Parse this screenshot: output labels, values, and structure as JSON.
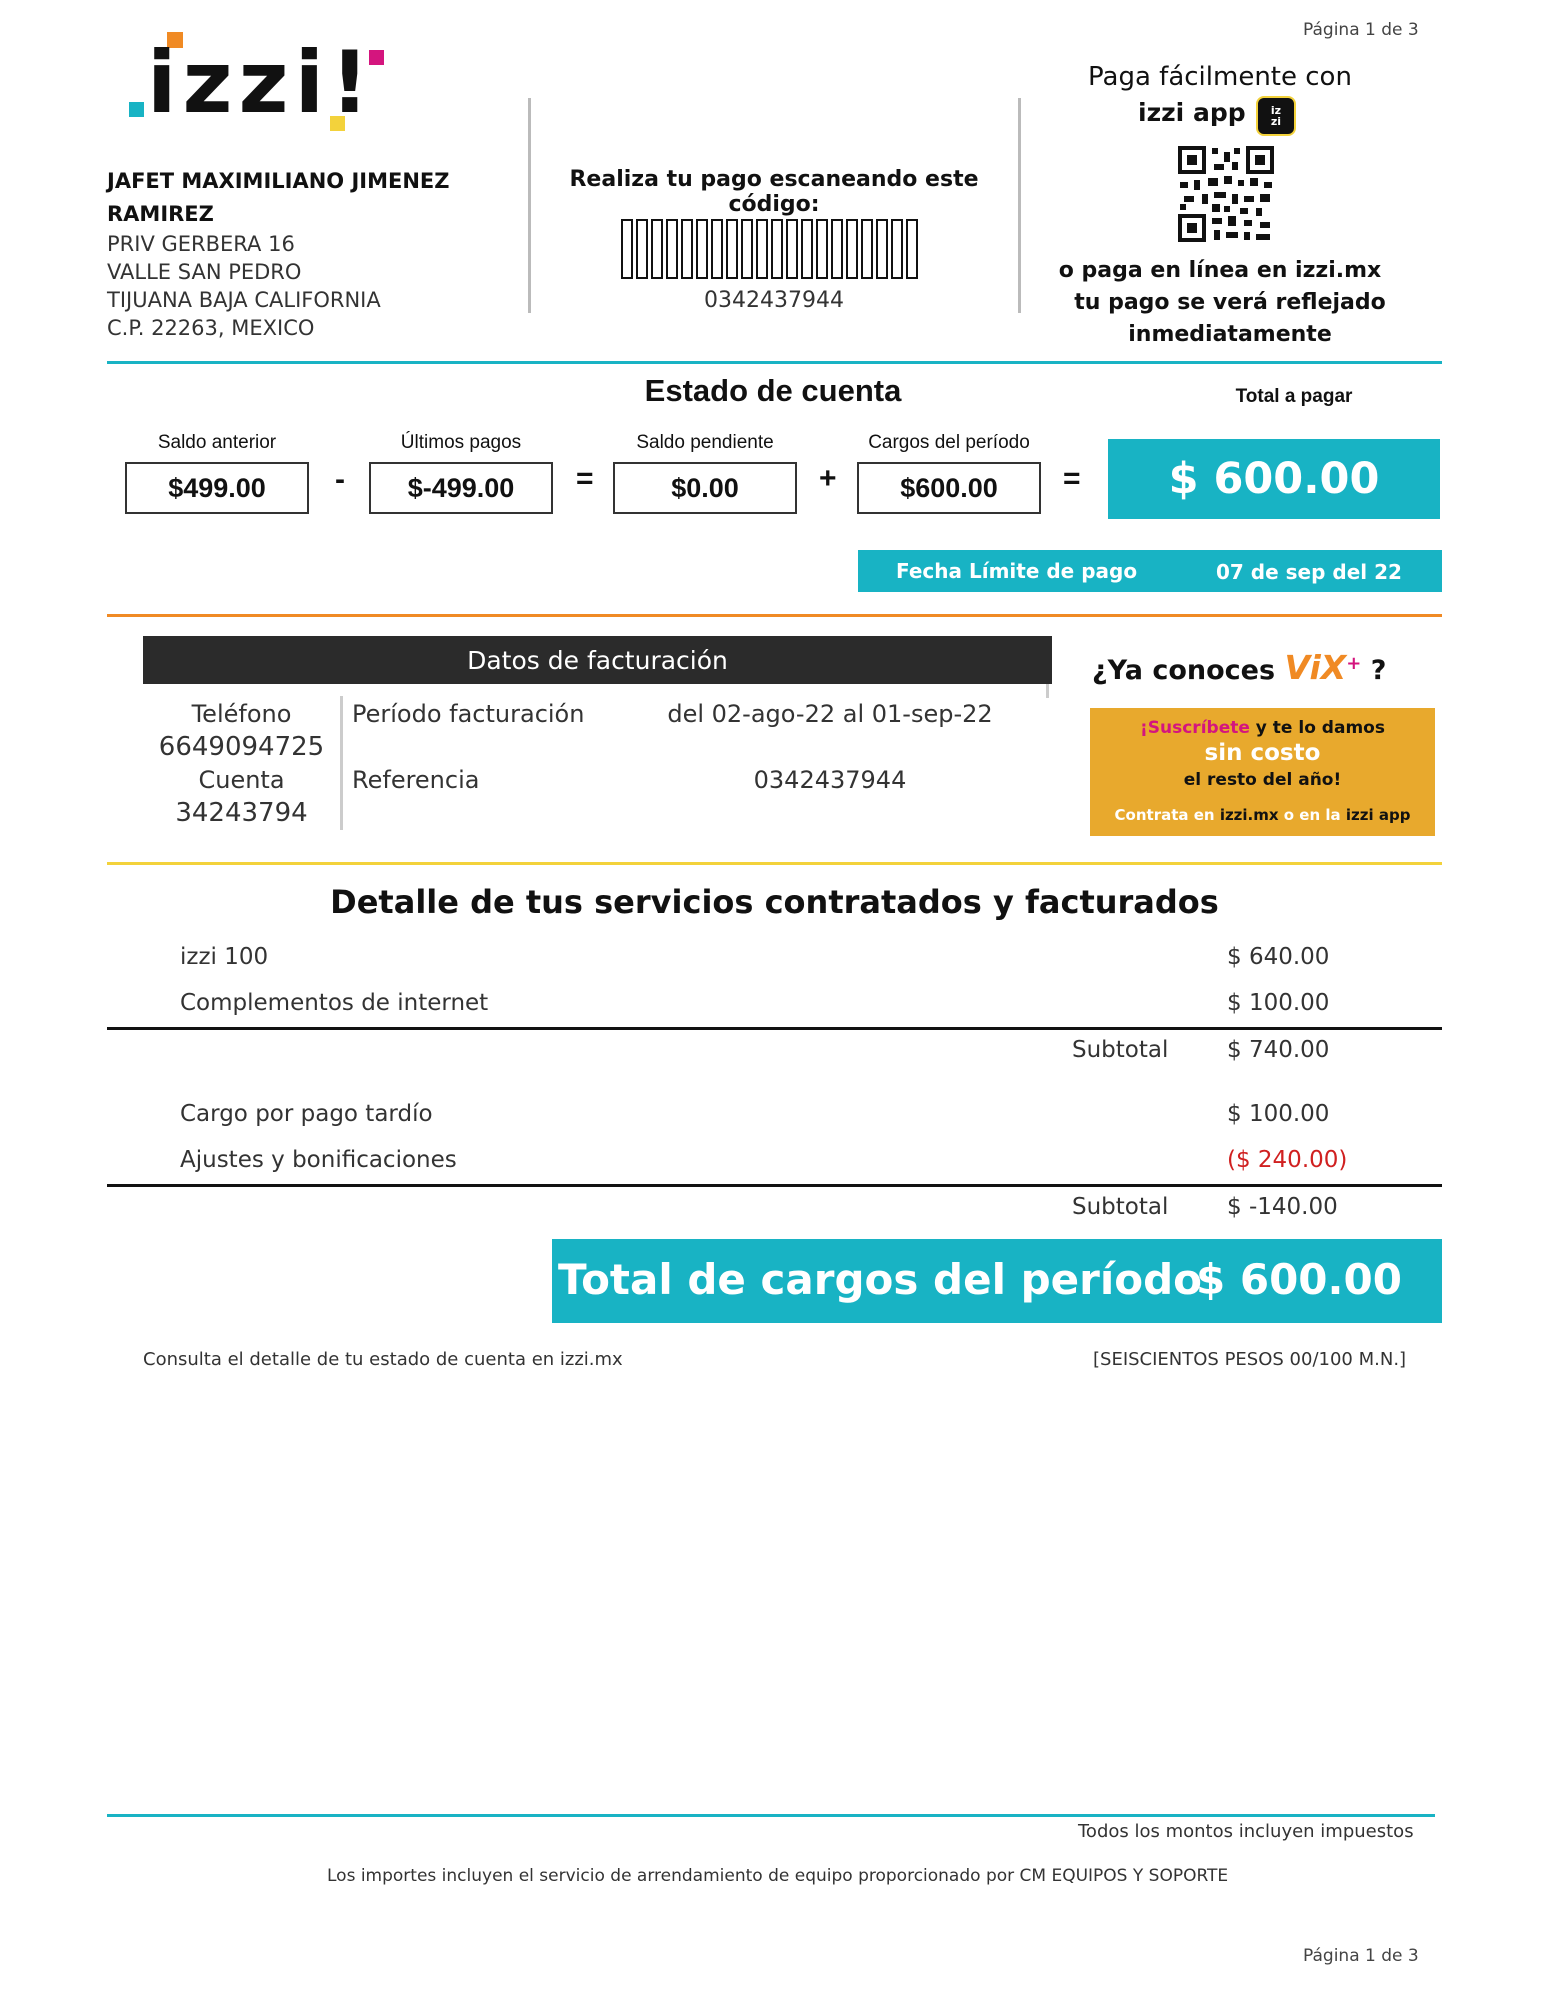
{
  "page": {
    "label": "Página 1 de 3"
  },
  "brand": {
    "logo_text": ".izzi!",
    "colors": {
      "teal": "#18b3c4",
      "orange": "#f08a24",
      "pink": "#d4157e",
      "yellow": "#f3d23b"
    }
  },
  "customer": {
    "name_line1": "JAFET MAXIMILIANO JIMENEZ",
    "name_line2": "RAMIREZ",
    "address": [
      "PRIV GERBERA 16",
      "VALLE SAN PEDRO",
      "TIJUANA BAJA CALIFORNIA",
      "C.P. 22263, MEXICO"
    ]
  },
  "barcode": {
    "title": "Realiza tu pago escaneando este código:",
    "number": "0342437944"
  },
  "app_pay": {
    "line1": "Paga fácilmente con",
    "line2": "izzi app",
    "line3": "o paga en línea en izzi.mx",
    "line4": "tu pago se verá reflejado",
    "line5": "inmediatamente"
  },
  "statement": {
    "title": "Estado de cuenta",
    "total_label": "Total a pagar",
    "total_amount": "$ 600.00",
    "items": [
      {
        "label": "Saldo anterior",
        "value": "$499.00"
      },
      {
        "label": "Últimos pagos",
        "value": "$-499.00"
      },
      {
        "label": "Saldo pendiente",
        "value": "$0.00"
      },
      {
        "label": "Cargos del período",
        "value": "$600.00"
      }
    ],
    "operators": [
      "-",
      "=",
      "+",
      "="
    ],
    "due_label": "Fecha Límite de pago",
    "due_date": "07 de sep del 22"
  },
  "billing": {
    "header": "Datos de facturación",
    "phone_label": "Teléfono",
    "phone": "6649094725",
    "account_label": "Cuenta",
    "account": "34243794",
    "period_label": "Período facturación",
    "period": "del 02-ago-22 al 01-sep-22",
    "reference_label": "Referencia",
    "reference": "0342437944"
  },
  "promo": {
    "question_prefix": "¿Ya conoces",
    "brand": "ViX",
    "brand_sup": "+",
    "question_suffix": "?",
    "line1_highlight": "¡Suscríbete",
    "line1_rest": " y te lo damos",
    "line2": "sin costo",
    "line3": "el resto del año!",
    "footer_a": "Contrata en ",
    "footer_b": "izzi.mx",
    "footer_c": " o en la ",
    "footer_d": "izzi app"
  },
  "services": {
    "title": "Detalle de tus servicios contratados y facturados",
    "group1": [
      {
        "label": "izzi 100",
        "amount": "$ 640.00"
      },
      {
        "label": "Complementos de internet",
        "amount": "$ 100.00"
      }
    ],
    "subtotal1_label": "Subtotal",
    "subtotal1": "$ 740.00",
    "group2": [
      {
        "label": "Cargo por pago tardío",
        "amount": "$ 100.00"
      },
      {
        "label": "Ajustes y bonificaciones",
        "amount": "($ 240.00)"
      }
    ],
    "subtotal2_label": "Subtotal",
    "subtotal2": "$ -140.00",
    "total_label": "Total de cargos del período",
    "total": "$ 600.00",
    "consult_note": "Consulta el detalle de tu estado de cuenta en izzi.mx",
    "amount_words": "[SEISCIENTOS PESOS 00/100 M.N.]"
  },
  "footer": {
    "taxes_note": "Todos los montos incluyen impuestos",
    "equipment_note": "Los importes incluyen el servicio de arrendamiento de equipo proporcionado por CM EQUIPOS Y SOPORTE",
    "page_label": "Página 1 de 3"
  }
}
